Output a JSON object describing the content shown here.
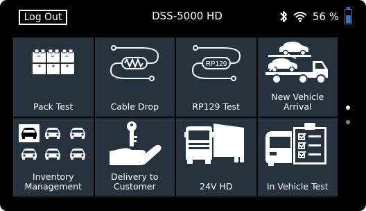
{
  "header": {
    "logout_label": "Log Out",
    "device_title": "DSS-5000 HD",
    "battery_percent": "56 %",
    "battery_level": 0.56,
    "icons": [
      "bluetooth-icon",
      "wifi-icon",
      "battery-icon"
    ]
  },
  "tiles": [
    {
      "label": "Pack Test",
      "icon": "battery-pack-icon"
    },
    {
      "label": "Cable Drop",
      "icon": "cable-resistor-icon"
    },
    {
      "label": "RP129 Test",
      "icon": "rp129-cable-icon"
    },
    {
      "label": "New Vehicle\nArrival",
      "icon": "car-transport-truck-icon"
    },
    {
      "label": "Inventory\nManagement",
      "icon": "car-grid-icon"
    },
    {
      "label": "Delivery to\nCustomer",
      "icon": "key-hand-icon"
    },
    {
      "label": "24V HD",
      "icon": "semi-truck-icon"
    },
    {
      "label": "In Vehicle Test",
      "icon": "car-checklist-icon"
    }
  ],
  "rp129_text": "RP129",
  "pagination": {
    "pages": 2,
    "current": 1
  },
  "colors": {
    "tile_bg": "#26323d",
    "accent_blue": "#2f74d0",
    "screen_bg": "#000000"
  }
}
